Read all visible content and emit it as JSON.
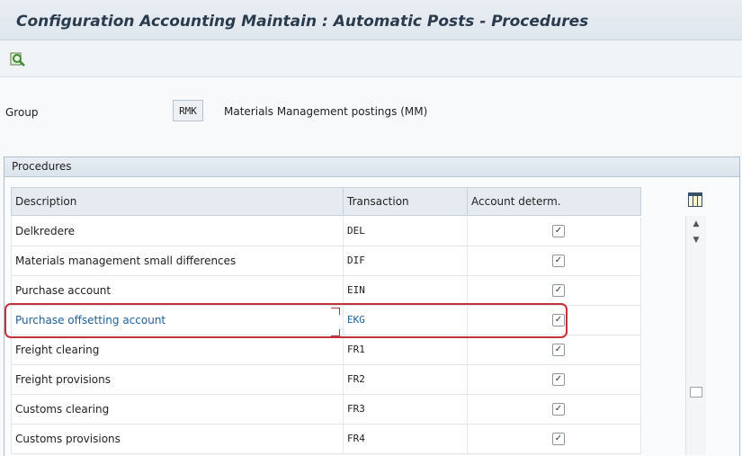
{
  "window": {
    "title": "Configuration Accounting Maintain : Automatic Posts - Procedures"
  },
  "toolbar": {
    "buttons": [
      {
        "icon": "find-icon",
        "color": "#3a8a2e"
      }
    ]
  },
  "group": {
    "label": "Group",
    "code": "RMK",
    "description": "Materials Management postings (MM)"
  },
  "procedures": {
    "title": "Procedures",
    "columns": {
      "description": "Description",
      "transaction": "Transaction",
      "account_determination": "Account determ."
    },
    "rows": [
      {
        "description": "Delkredere",
        "transaction": "DEL",
        "checked": true
      },
      {
        "description": "Materials management small differences",
        "transaction": "DIF",
        "checked": true
      },
      {
        "description": "Purchase account",
        "transaction": "EIN",
        "checked": true
      },
      {
        "description": "Purchase offsetting account",
        "transaction": "EKG",
        "checked": true,
        "selected": true
      },
      {
        "description": "Freight clearing",
        "transaction": "FR1",
        "checked": true
      },
      {
        "description": "Freight provisions",
        "transaction": "FR2",
        "checked": true
      },
      {
        "description": "Customs clearing",
        "transaction": "FR3",
        "checked": true
      },
      {
        "description": "Customs provisions",
        "transaction": "FR4",
        "checked": true
      }
    ],
    "checkmark": "✓"
  },
  "colors": {
    "highlight": "#c2343a",
    "selected_text": "#1f5f9a",
    "title_text": "#2a3b4d"
  }
}
